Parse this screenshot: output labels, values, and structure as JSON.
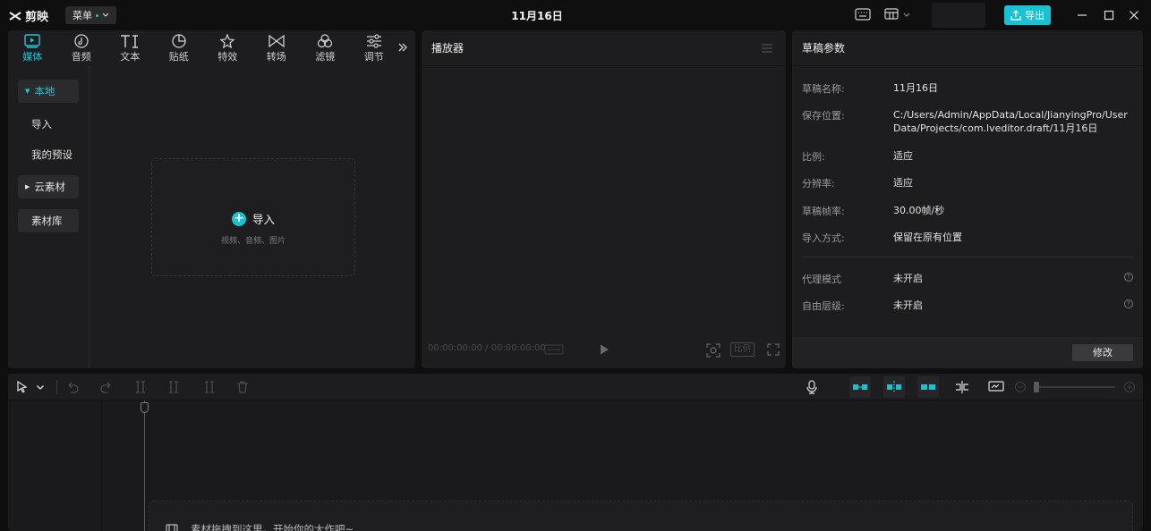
{
  "app": {
    "logo_text": "剪映",
    "menu_label": "菜单",
    "window_title": "11月16日",
    "export_label": "导出"
  },
  "media_panel": {
    "tabs": [
      {
        "label": "媒体",
        "icon": "media-icon",
        "active": true
      },
      {
        "label": "音频",
        "icon": "audio-icon",
        "active": false
      },
      {
        "label": "文本",
        "icon": "text-icon",
        "active": false
      },
      {
        "label": "贴纸",
        "icon": "sticker-icon",
        "active": false
      },
      {
        "label": "特效",
        "icon": "effects-icon",
        "active": false
      },
      {
        "label": "转场",
        "icon": "transition-icon",
        "active": false
      },
      {
        "label": "滤镜",
        "icon": "filter-icon",
        "active": false
      },
      {
        "label": "调节",
        "icon": "adjust-icon",
        "active": false
      }
    ],
    "sidebar": [
      {
        "label": "本地",
        "active": true,
        "caret": true
      },
      {
        "label": "导入",
        "active": false,
        "caret": false
      },
      {
        "label": "我的预设",
        "active": false,
        "caret": false
      },
      {
        "label": "云素材",
        "active": false,
        "caret": true
      },
      {
        "label": "素材库",
        "active": false,
        "caret": false
      }
    ],
    "import": {
      "label": "导入",
      "hint": "视频、音频、图片"
    }
  },
  "player": {
    "title": "播放器",
    "timecode": "00:00:00:00 / 00:00:00:00",
    "ratio_label": "比例"
  },
  "params": {
    "title": "草稿参数",
    "rows": [
      {
        "key": "草稿名称:",
        "value": "11月16日"
      },
      {
        "key": "保存位置:",
        "value": "C:/Users/Admin/AppData/Local/JianyingPro/User Data/Projects/com.lveditor.draft/11月16日"
      },
      {
        "key": "比例:",
        "value": "适应"
      },
      {
        "key": "分辨率:",
        "value": "适应"
      },
      {
        "key": "草稿帧率:",
        "value": "30.00帧/秒"
      },
      {
        "key": "导入方式:",
        "value": "保留在原有位置"
      },
      {
        "key": "代理模式",
        "value": "未开启"
      },
      {
        "key": "自由层级:",
        "value": "未开启"
      }
    ],
    "modify_label": "修改"
  },
  "timeline": {
    "drop_hint": "素材拖拽到这里，开始你的大作吧~"
  },
  "colors": {
    "accent": "#19c2d1",
    "panel": "#1d1d1f",
    "background": "#0f0f10"
  }
}
